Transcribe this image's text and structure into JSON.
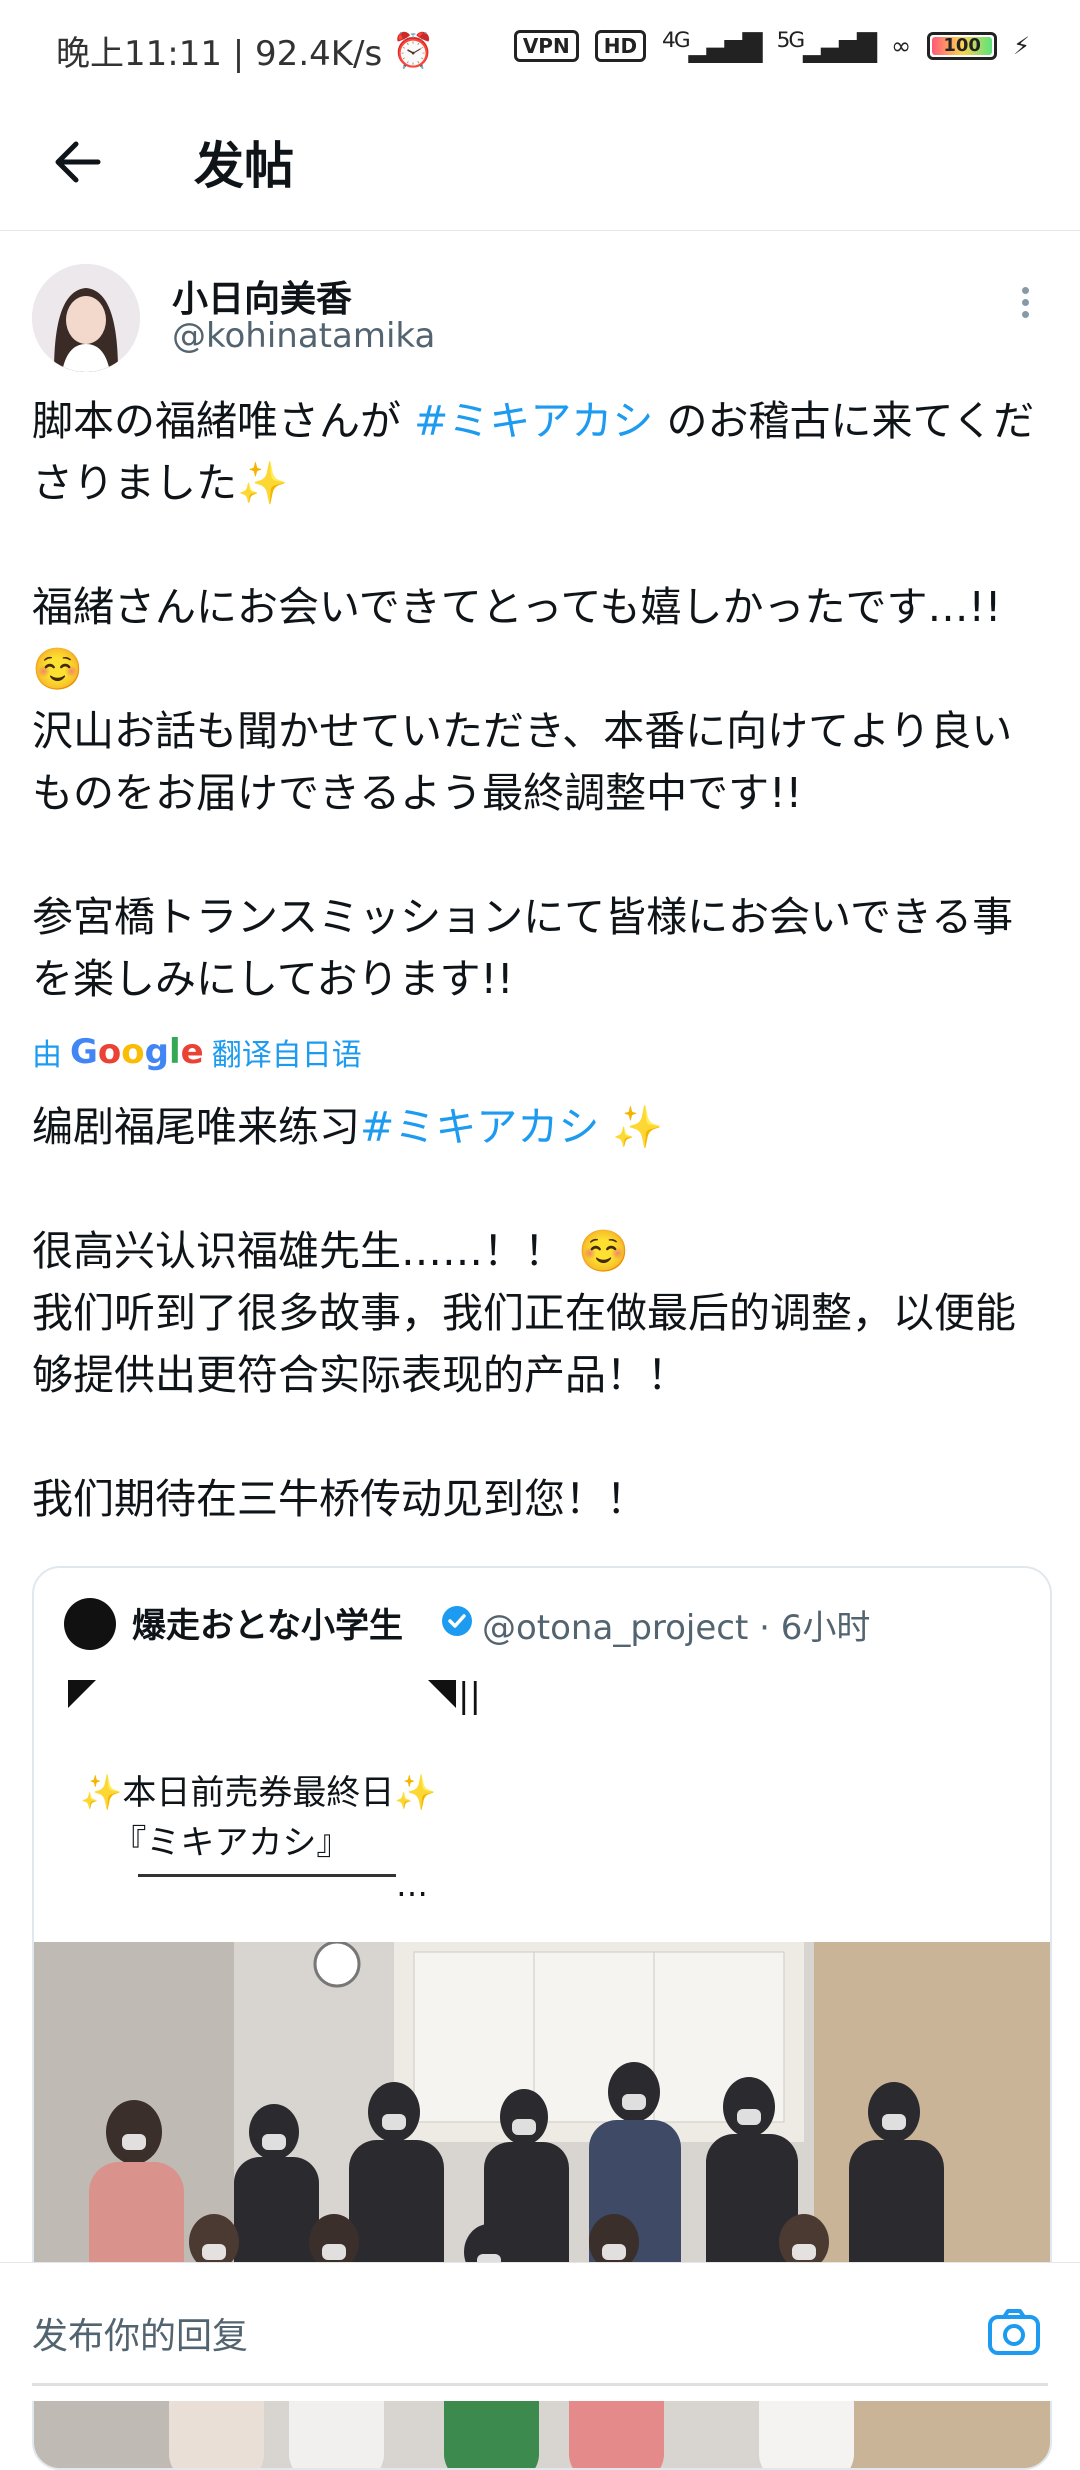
{
  "status_bar": {
    "time_speed": "晚上11:11 | 92.4K/s",
    "vpn": "VPN",
    "hd": "HD",
    "net1": "4G",
    "net2": "5G",
    "battery": "100"
  },
  "header": {
    "title": "发帖"
  },
  "tweet": {
    "author_name": "小日向美香",
    "author_handle": "@kohinatamika",
    "orig": {
      "l1_pre": "脚本の福緒唯さんが ",
      "hashtag": "#ミキアカシ",
      "l1_post": " のお稽古に来てくださりました✨\n\n福緒さんにお会いできてとっても嬉しかったです…!! ☺️\n沢山お話も聞かせていただき、本番に向けてより良いものをお届けできるよう最終調整中です!!\n\n参宮橋トランスミッションにて皆様にお会いできる事を楽しみにしております!!"
    },
    "translate": {
      "prefix": "由",
      "suffix": "翻译自日语"
    },
    "trans": {
      "pre": "编剧福尾唯来练习",
      "hashtag": "#ミキアカシ",
      "post": " ✨\n\n很高兴认识福雄先生……！！ ☺️\n我们听到了很多故事，我们正在做最后的调整，以便能够提供出更符合实际表现的产品！！\n\n我们期待在三牛桥传动见到您！！"
    }
  },
  "quote": {
    "name": "爆走おとな小学生",
    "handle": "@otona_project · 6小时",
    "text": "✨本日前売券最終日✨\n   『ミキアカシ』",
    "ellipsis": "…"
  },
  "reply": {
    "placeholder": "发布你的回复"
  },
  "colors": {
    "link": "#1d9bf0",
    "muted": "#536471"
  }
}
